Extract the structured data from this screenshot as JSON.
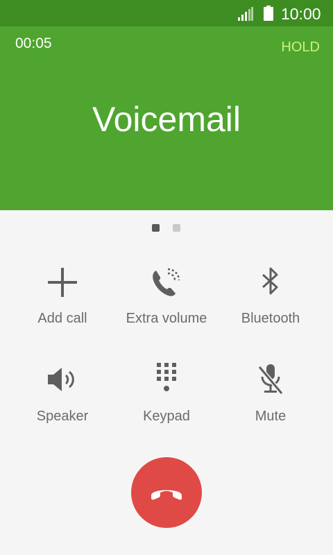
{
  "status_bar": {
    "time": "10:00",
    "icons": [
      "signal-icon",
      "battery-icon"
    ],
    "background_color": "#3e8d23"
  },
  "call": {
    "duration": "00:05",
    "hold_label": "HOLD",
    "caller_name": "Voicemail",
    "header_color": "#4fa52f",
    "hold_color": "#c8f57a"
  },
  "pager": {
    "pages": 2,
    "current_page": 1
  },
  "actions": [
    {
      "label": "Add call",
      "icon": "plus-icon"
    },
    {
      "label": "Extra volume",
      "icon": "extra-volume-icon"
    },
    {
      "label": "Bluetooth",
      "icon": "bluetooth-icon"
    },
    {
      "label": "Speaker",
      "icon": "speaker-icon"
    },
    {
      "label": "Keypad",
      "icon": "keypad-icon"
    },
    {
      "label": "Mute",
      "icon": "mute-icon"
    }
  ],
  "end_call": {
    "icon": "end-call-icon",
    "color": "#e04a46"
  }
}
